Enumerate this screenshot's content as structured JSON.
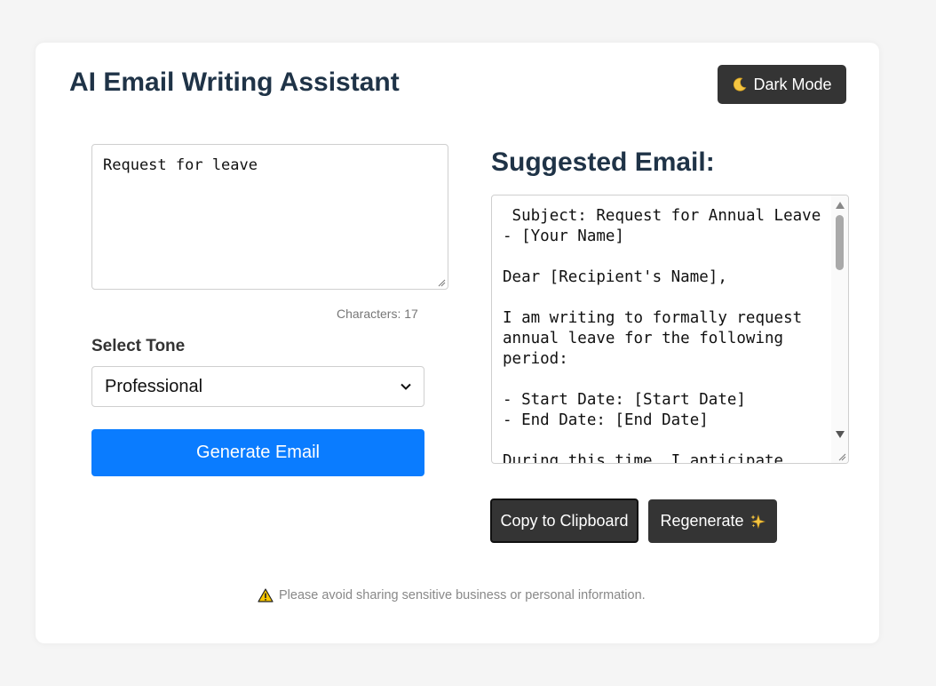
{
  "header": {
    "title": "AI Email Writing Assistant",
    "dark_mode_label": "Dark Mode",
    "dark_mode_icon": "moon-icon"
  },
  "composer": {
    "input_value": "Request for leave",
    "char_count_text": "Characters: 17",
    "tone_label": "Select Tone",
    "tone_selected": "Professional",
    "generate_label": "Generate Email"
  },
  "output": {
    "heading": "Suggested Email:",
    "email_text": " Subject: Request for Annual Leave - [Your Name]\n\nDear [Recipient's Name],\n\nI am writing to formally request annual leave for the following period:\n\n- Start Date: [Start Date]\n- End Date: [End Date]\n\nDuring this time, I anticipate",
    "copy_label": "Copy to Clipboard",
    "regenerate_label": "Regenerate",
    "regenerate_icon": "sparkles-icon"
  },
  "footer": {
    "disclaimer": "Please avoid sharing sensitive business or personal information.",
    "warning_icon": "warning-icon"
  },
  "colors": {
    "primary": "#0a7cff",
    "dark_button": "#343434",
    "heading": "#1f3347",
    "background": "#f5f5f5"
  }
}
